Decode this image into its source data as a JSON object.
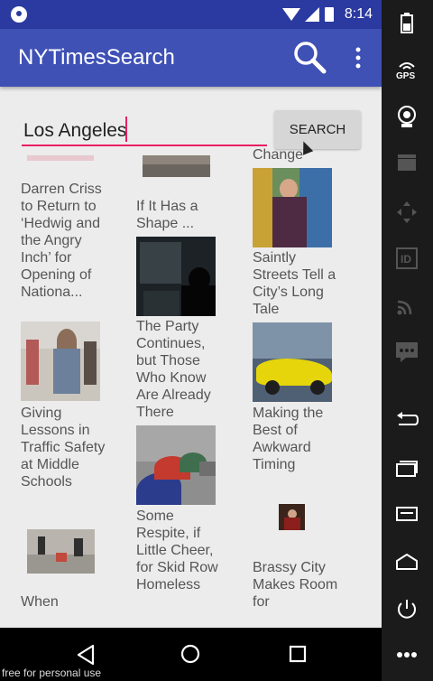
{
  "status_bar": {
    "time": "8:14"
  },
  "app_bar": {
    "title": "NYTimesSearch"
  },
  "search": {
    "value": "Los Angeles",
    "button_label": "SEARCH"
  },
  "articles": [
    {
      "headline": "Darren Criss to Return to ‘Hedwig and the Angry Inch’ for Opening of Nationa..."
    },
    {
      "headline": "If It Has a Shape ..."
    },
    {
      "headline": "Change"
    },
    {
      "headline": "Saintly Streets Tell a City’s Long Tale"
    },
    {
      "headline": "The Party Continues, but Those Who Know Are Already There"
    },
    {
      "headline": "Giving Lessons in Traffic Safety at Middle Schools"
    },
    {
      "headline": "Making the Best of Awkward Timing"
    },
    {
      "headline": "Some Respite, if Little Cheer, for Skid Row Homeless"
    },
    {
      "headline": "When"
    },
    {
      "headline": "Brassy City Makes Room for"
    }
  ],
  "watermark": "free for personal use",
  "colors": {
    "primary": "#3f51b5",
    "primary_dark": "#2b3aa0",
    "accent": "#e91e63"
  }
}
